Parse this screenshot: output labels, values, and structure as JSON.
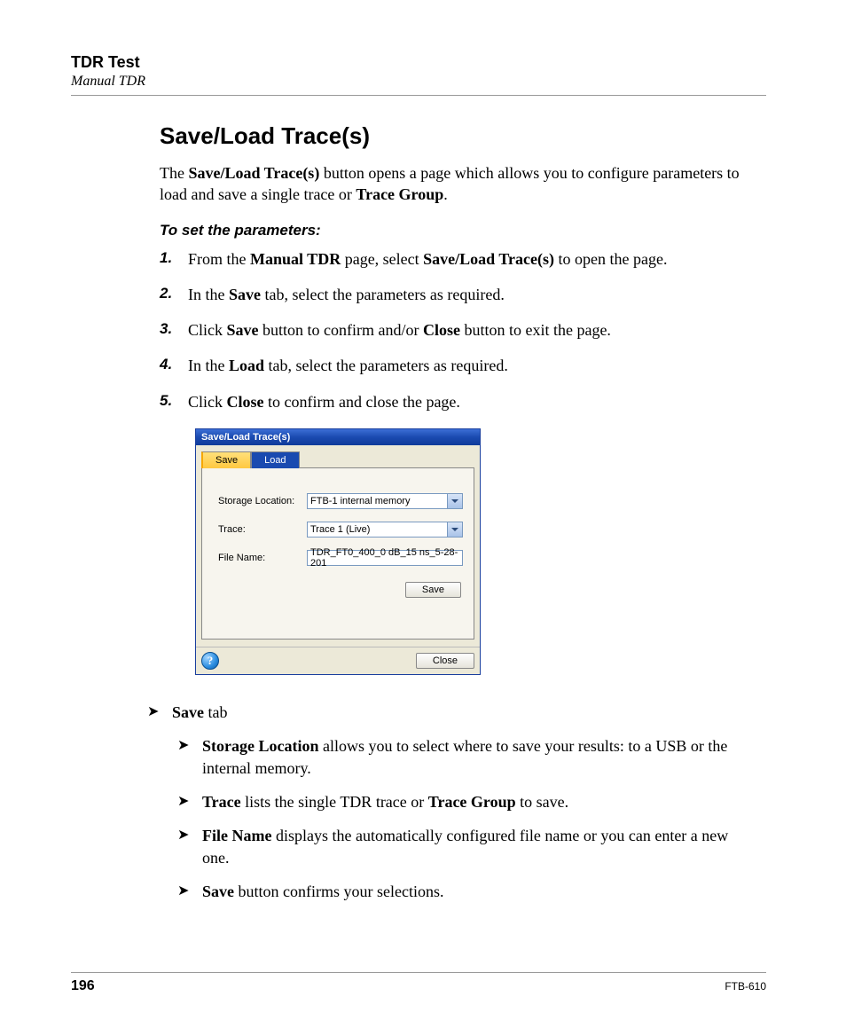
{
  "header": {
    "title": "TDR Test",
    "subtitle": "Manual TDR"
  },
  "section": {
    "heading": "Save/Load Trace(s)",
    "intro_pre": "The ",
    "intro_b1": "Save/Load Trace(s)",
    "intro_mid": " button opens a page which allows you to configure parameters to load and save a single trace or ",
    "intro_b2": "Trace Group",
    "intro_post": ".",
    "subhead": "To set the parameters:"
  },
  "steps": {
    "s1_a": "From the ",
    "s1_b1": "Manual TDR",
    "s1_mid": " page, select ",
    "s1_b2": "Save/Load Trace(s)",
    "s1_end": " to open the page.",
    "s2_a": "In the ",
    "s2_b": "Save",
    "s2_end": " tab, select the parameters as required.",
    "s3_a": "Click ",
    "s3_b1": "Save",
    "s3_mid": " button to confirm and/or ",
    "s3_b2": "Close",
    "s3_end": " button to exit the page.",
    "s4_a": "In the ",
    "s4_b": "Load",
    "s4_end": " tab, select the parameters as required.",
    "s5_a": "Click ",
    "s5_b": "Close",
    "s5_end": " to confirm and close the page."
  },
  "dialog": {
    "title": "Save/Load Trace(s)",
    "tab_save": "Save",
    "tab_load": "Load",
    "lbl_storage": "Storage Location:",
    "val_storage": "FTB-1 internal memory",
    "lbl_trace": "Trace:",
    "val_trace": "Trace 1 (Live)",
    "lbl_file": "File Name:",
    "val_file": "TDR_FT0_400_0 dB_15 ns_5-28-201",
    "btn_save": "Save",
    "btn_close": "Close",
    "help": "?"
  },
  "bullets": {
    "save_tab_b": "Save",
    "save_tab_t": " tab",
    "storage_b": "Storage Location",
    "storage_t": " allows you to select where to save your results: to a USB or the internal memory.",
    "trace_b": "Trace",
    "trace_mid": " lists the single TDR trace or ",
    "trace_b2": "Trace Group",
    "trace_end": " to save.",
    "file_b": "File Name",
    "file_t": " displays the automatically configured file name or you can enter a new one.",
    "savebtn_b": "Save",
    "savebtn_t": " button confirms your selections."
  },
  "footer": {
    "page": "196",
    "model": "FTB-610"
  }
}
